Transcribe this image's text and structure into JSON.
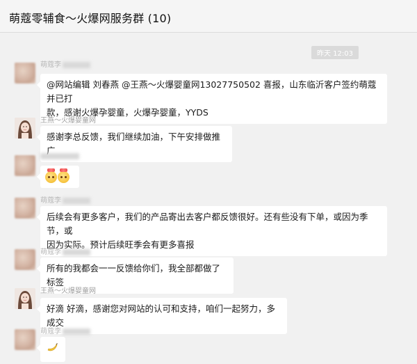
{
  "chat": {
    "title": "萌蔻零辅食～火爆网服务群 (10)",
    "timestamp": "昨天 12:03"
  },
  "messages": [
    {
      "sender": "萌蔻李",
      "blurred": true,
      "lines": [
        "@网站编辑 刘春燕 @王燕～火爆婴童网13027750502 喜报，山东临沂客户签约萌蔻并已打",
        "款，感谢火爆孕婴童，火爆孕婴童，YYDS"
      ]
    },
    {
      "sender": "王燕～火爆婴童网",
      "blurred": false,
      "lines": [
        "感谢李总反馈，我们继续加油，下午安排做推广"
      ]
    },
    {
      "sender": "",
      "blurred": true,
      "emoji": "face-party-emoji",
      "lines": []
    },
    {
      "sender": "萌蔻李",
      "blurred": true,
      "lines": [
        "后续会有更多客户，我们的产品寄出去客户都反馈很好。还有些没有下单，或因为季节，或",
        "因为实际。预计后续旺季会有更多喜报"
      ]
    },
    {
      "sender": "萌蔻李",
      "blurred": true,
      "lines": [
        "所有的我都会一一反馈给你们，我全部都做了标签"
      ]
    },
    {
      "sender": "王燕～火爆婴童网",
      "blurred": false,
      "lines": [
        "好滴 好滴，感谢您对网站的认可和支持，咱们一起努力，多成交"
      ]
    },
    {
      "sender": "萌蔻李",
      "blurred": true,
      "emoji": "banana-emoji",
      "lines": []
    }
  ],
  "icons": {
    "party": "face-party-emoji",
    "banana": "banana-emoji"
  }
}
